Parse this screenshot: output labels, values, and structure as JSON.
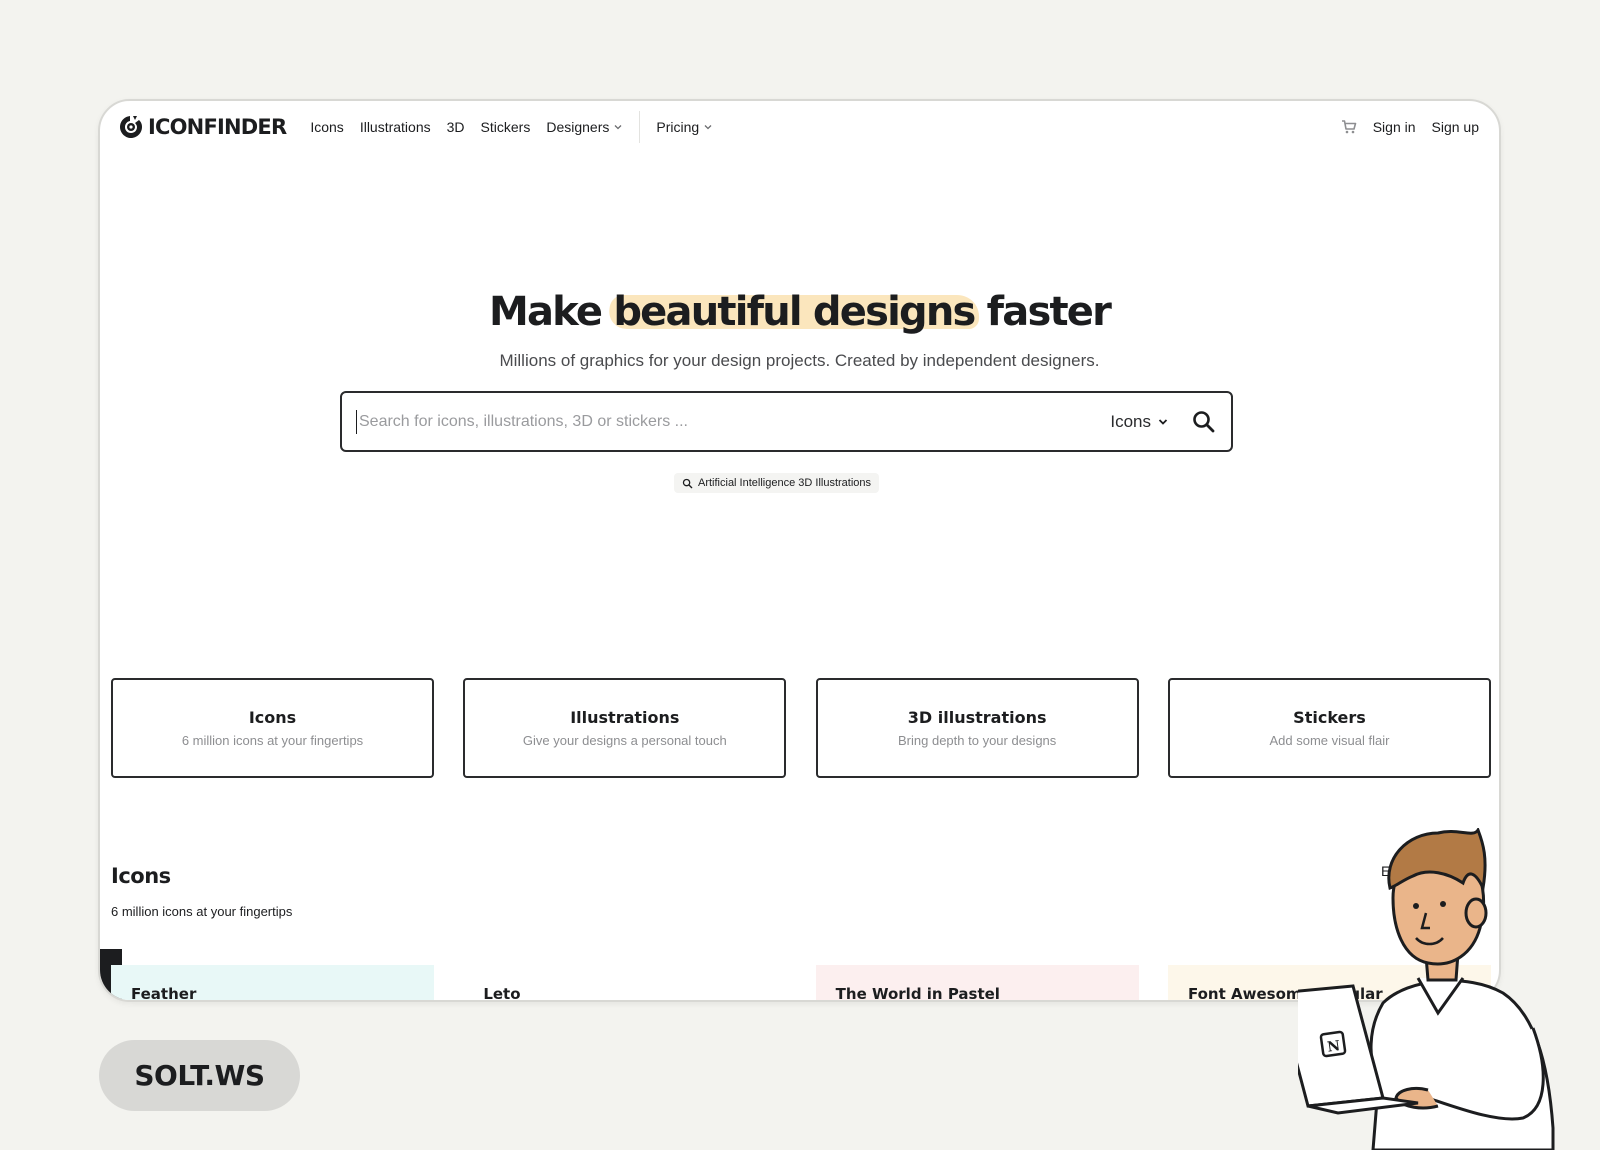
{
  "nav": {
    "logo_text": "ICONFINDER",
    "links": [
      "Icons",
      "Illustrations",
      "3D",
      "Stickers",
      "Designers"
    ],
    "pricing": "Pricing",
    "sign_in": "Sign in",
    "sign_up": "Sign up"
  },
  "hero": {
    "title_before": "Make ",
    "title_highlight": "beautiful designs",
    "title_after": " faster",
    "subtitle": "Millions of graphics for your design projects. Created by independent designers."
  },
  "search": {
    "placeholder": "Search for icons, illustrations, 3D or stickers ...",
    "value": "",
    "type_selected": "Icons",
    "suggestion": "Artificial Intelligence 3D Illustrations"
  },
  "categories": [
    {
      "title": "Icons",
      "subtitle": "6 million icons at your fingertips"
    },
    {
      "title": "Illustrations",
      "subtitle": "Give your designs a personal touch"
    },
    {
      "title": "3D illustrations",
      "subtitle": "Bring depth to your designs"
    },
    {
      "title": "Stickers",
      "subtitle": "Add some visual flair"
    }
  ],
  "icons_section": {
    "title": "Icons",
    "subtitle": "6 million icons at your fingertips",
    "explore_link": "Exp",
    "sets": [
      {
        "name": "Feather",
        "bg": "#e8f8f7"
      },
      {
        "name": "Leto",
        "bg": "#ffffff"
      },
      {
        "name": "The World in Pastel",
        "bg": "#fcefef"
      },
      {
        "name": "Font Awesome Regular",
        "bg": "#fdf7ea"
      }
    ]
  },
  "badge": "SOLT.WS",
  "colors": {
    "background": "#f3f3ef",
    "highlight": "#fbe3b6",
    "text": "#1c1d1f",
    "muted": "#8d8e91"
  }
}
